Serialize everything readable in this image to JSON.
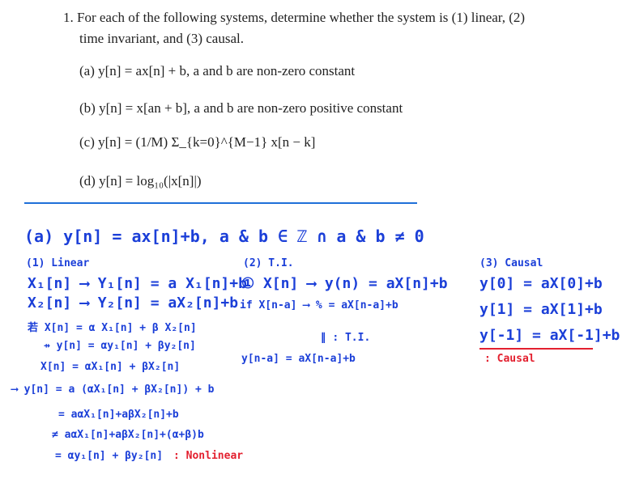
{
  "problem": {
    "intro_line1": "1. For each of the following systems, determine whether the system is (1) linear, (2)",
    "intro_line2": "time invariant, and (3) causal.",
    "parts": [
      "(a) y[n] = ax[n] + b,  a  and  b  are non-zero constant",
      "(b) y[n] = x[an + b],  a  and  b  are non-zero positive constant",
      "(c) y[n] = (1/M) Σ_{k=0}^{M−1} x[n − k]",
      "(d) y[n] = log₁₀(|x[n]|)"
    ]
  },
  "handwritten": {
    "heading": "(a) y[n] = ax[n]+b,  a & b ∈ ℤ ∩ a & b ≠ 0",
    "linear": {
      "title": "(1) Linear",
      "lines": [
        "X₁[n] ⟶ Y₁[n] = a X₁[n]+b",
        "X₂[n] ⟶ Y₂[n] = aX₂[n]+b",
        "若 X[n] = α X₁[n] + β X₂[n]",
        "⇸ y[n] = αy₁[n] + βy₂[n]",
        "X[n] = αX₁[n] + βX₂[n]",
        "⟶ y[n] = a (αX₁[n] + βX₂[n]) + b",
        "= aαX₁[n]+aβX₂[n]+b",
        "≠ aαX₁[n]+aβX₂[n]+(α+β)b",
        "= αy₁[n] + βy₂[n]"
      ],
      "verdict": ": Nonlinear"
    },
    "ti": {
      "title": "(2) T.I.",
      "line1": "① X[n] ⟶ y(n) = aX[n]+b",
      "line2": "if X[n-a] ⟶ % = aX[n-a]+b",
      "line3": "∥  : T.I.",
      "line4": "y[n-a] = aX[n-a]+b"
    },
    "causal": {
      "title": "(3) Causal",
      "lines": [
        "y[0] = aX[0]+b",
        "y[1] = aX[1]+b",
        "y[-1] = aX[-1]+b"
      ],
      "verdict": ": Causal"
    }
  }
}
